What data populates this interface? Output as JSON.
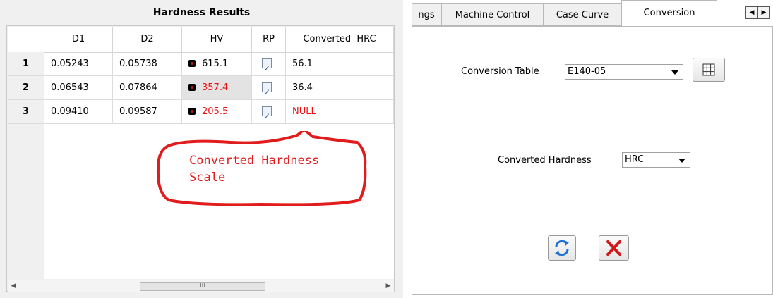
{
  "left_panel": {
    "title": "Hardness Results",
    "columns": [
      "D1",
      "D2",
      "HV",
      "RP",
      "Converted  HRC"
    ],
    "rows": [
      {
        "num": "1",
        "d1": "0.05243",
        "d2": "0.05738",
        "hv": "615.1",
        "rp_checked": true,
        "hrc": "56.1",
        "hv_red": false,
        "hrc_red": false
      },
      {
        "num": "2",
        "d1": "0.06543",
        "d2": "0.07864",
        "hv": "357.4",
        "rp_checked": true,
        "hrc": "36.4",
        "hv_red": true,
        "hrc_red": false
      },
      {
        "num": "3",
        "d1": "0.09410",
        "d2": "0.09587",
        "hv": "205.5",
        "rp_checked": true,
        "hrc": "NULL",
        "hv_red": true,
        "hrc_red": true
      }
    ],
    "scrollbar_grip": "III"
  },
  "callout": {
    "line1": "Converted Hardness",
    "line2": "Scale",
    "color": "#e01c1c"
  },
  "right_panel": {
    "tabs": [
      "ngs",
      "Machine Control",
      "Case Curve",
      "Conversion"
    ],
    "active_tab": "Conversion",
    "conversion_table_label": "Conversion Table",
    "conversion_table_value": "E140-05",
    "converted_hardness_label": "Converted Hardness",
    "converted_hardness_value": "HRC",
    "icons": [
      "grid-icon",
      "refresh-icon",
      "cancel-icon"
    ]
  }
}
